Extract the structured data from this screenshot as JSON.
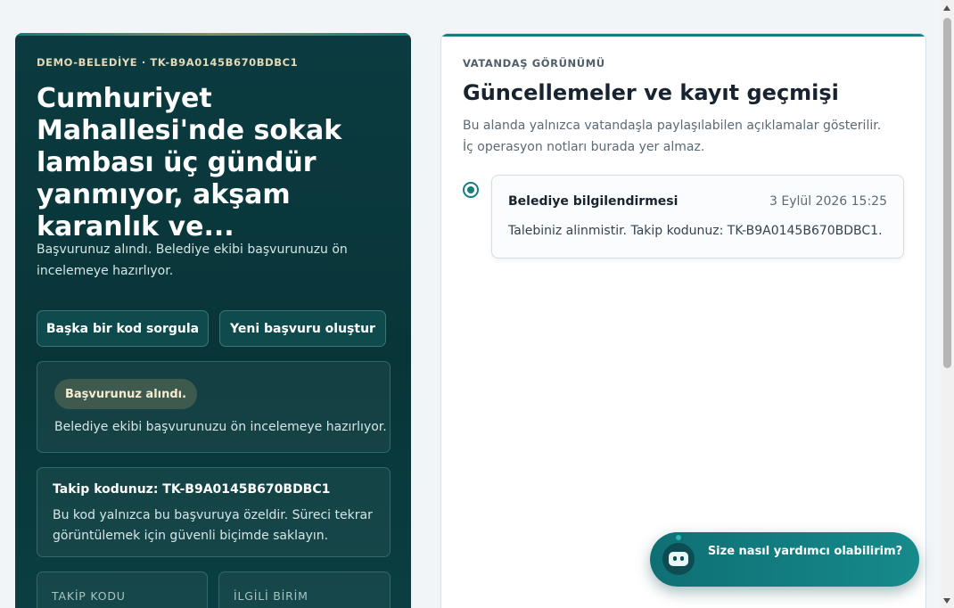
{
  "left": {
    "eyebrow": "DEMO-BELEDİYE · TK-B9A0145B670BDBC1",
    "title": "Cumhuriyet Mahallesi'nde sokak lambası üç gündür yanmıyor, akşam karanlık ve...",
    "intro": "Başvurunuz alındı. Belediye ekibi başvurunuzu ön incelemeye hazırlıyor.",
    "buttons": {
      "query_other": "Başka bir kod sorgula",
      "new_application": "Yeni başvuru oluştur"
    },
    "status": {
      "badge": "Başvurunuz alındı.",
      "text": "Belediye ekibi başvurunuzu ön incelemeye hazırlıyor."
    },
    "tracking": {
      "title": "Takip kodunuz: TK-B9A0145B670BDBC1",
      "description": "Bu kod yalnızca bu başvuruya özeldir. Süreci tekrar görüntülemek için güvenli biçimde saklayın."
    },
    "meta": {
      "tracking_code_label": "TAKİP KODU",
      "unit_label": "İLGİLİ BİRİM"
    }
  },
  "right": {
    "eyebrow": "VATANDAŞ GÖRÜNÜMÜ",
    "title": "Güncellemeler ve kayıt geçmişi",
    "description": "Bu alanda yalnızca vatandaşla paylaşılabilen açıklamalar gösterilir. İç operasyon notları burada yer almaz.",
    "entries": [
      {
        "title": "Belediye bilgilendirmesi",
        "date": "3 Eylül 2026 15:25",
        "body": "Talebiniz alinmistir. Takip kodunuz: TK-B9A0145B670BDBC1."
      }
    ]
  },
  "chat": {
    "label": "Size nasıl yardımcı olabilirim?",
    "icon": "robot-icon"
  },
  "colors": {
    "accent": "#167e82",
    "dark_panel": "#0b3b40",
    "badge_bg": "#3e5a4e"
  }
}
